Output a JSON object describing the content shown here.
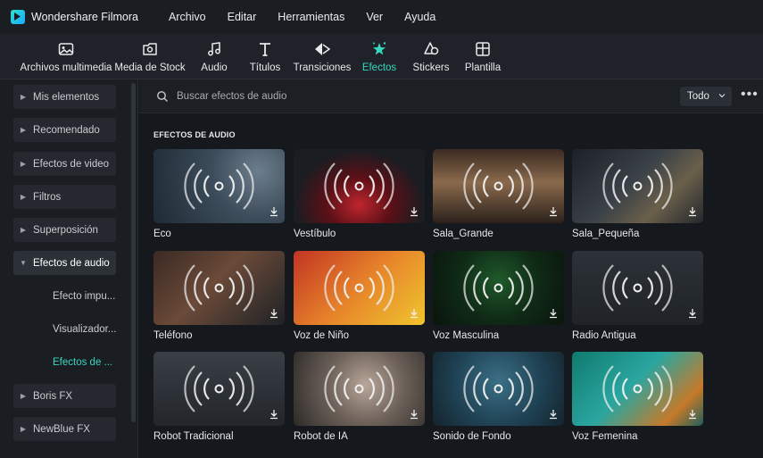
{
  "app": {
    "title": "Wondershare Filmora"
  },
  "menu": [
    "Archivo",
    "Editar",
    "Herramientas",
    "Ver",
    "Ayuda"
  ],
  "toolbar": [
    {
      "label": "Archivos multimedia",
      "icon": "media-icon"
    },
    {
      "label": "Media de Stock",
      "icon": "stock-icon"
    },
    {
      "label": "Audio",
      "icon": "music-note-icon"
    },
    {
      "label": "Títulos",
      "icon": "title-icon"
    },
    {
      "label": "Transiciones",
      "icon": "transition-icon"
    },
    {
      "label": "Efectos",
      "icon": "effects-icon",
      "active": true
    },
    {
      "label": "Stickers",
      "icon": "sticker-icon"
    },
    {
      "label": "Plantilla",
      "icon": "template-icon"
    }
  ],
  "sidebar": {
    "items": [
      "Mis elementos",
      "Recomendado",
      "Efectos de video",
      "Filtros",
      "Superposición",
      "Efectos de audio",
      "Boris FX",
      "NewBlue FX"
    ],
    "sub_items": [
      "Efecto impu...",
      "Visualizador...",
      "Efectos de ..."
    ]
  },
  "search": {
    "placeholder": "Buscar efectos de audio"
  },
  "filter": {
    "value": "Todo"
  },
  "section": {
    "title": "EFECTOS DE AUDIO"
  },
  "effects": [
    "Eco",
    "Vestíbulo",
    "Sala_Grande",
    "Sala_Pequeña",
    "Teléfono",
    "Voz de Niño",
    "Voz Masculina",
    "Radio Antigua",
    "Robot Tradicional",
    "Robot de IA",
    "Sonido de Fondo",
    "Voz Femenina"
  ],
  "colors": {
    "accent": "#37d7c1",
    "background": "#15181d",
    "panel": "#1a1d22"
  }
}
